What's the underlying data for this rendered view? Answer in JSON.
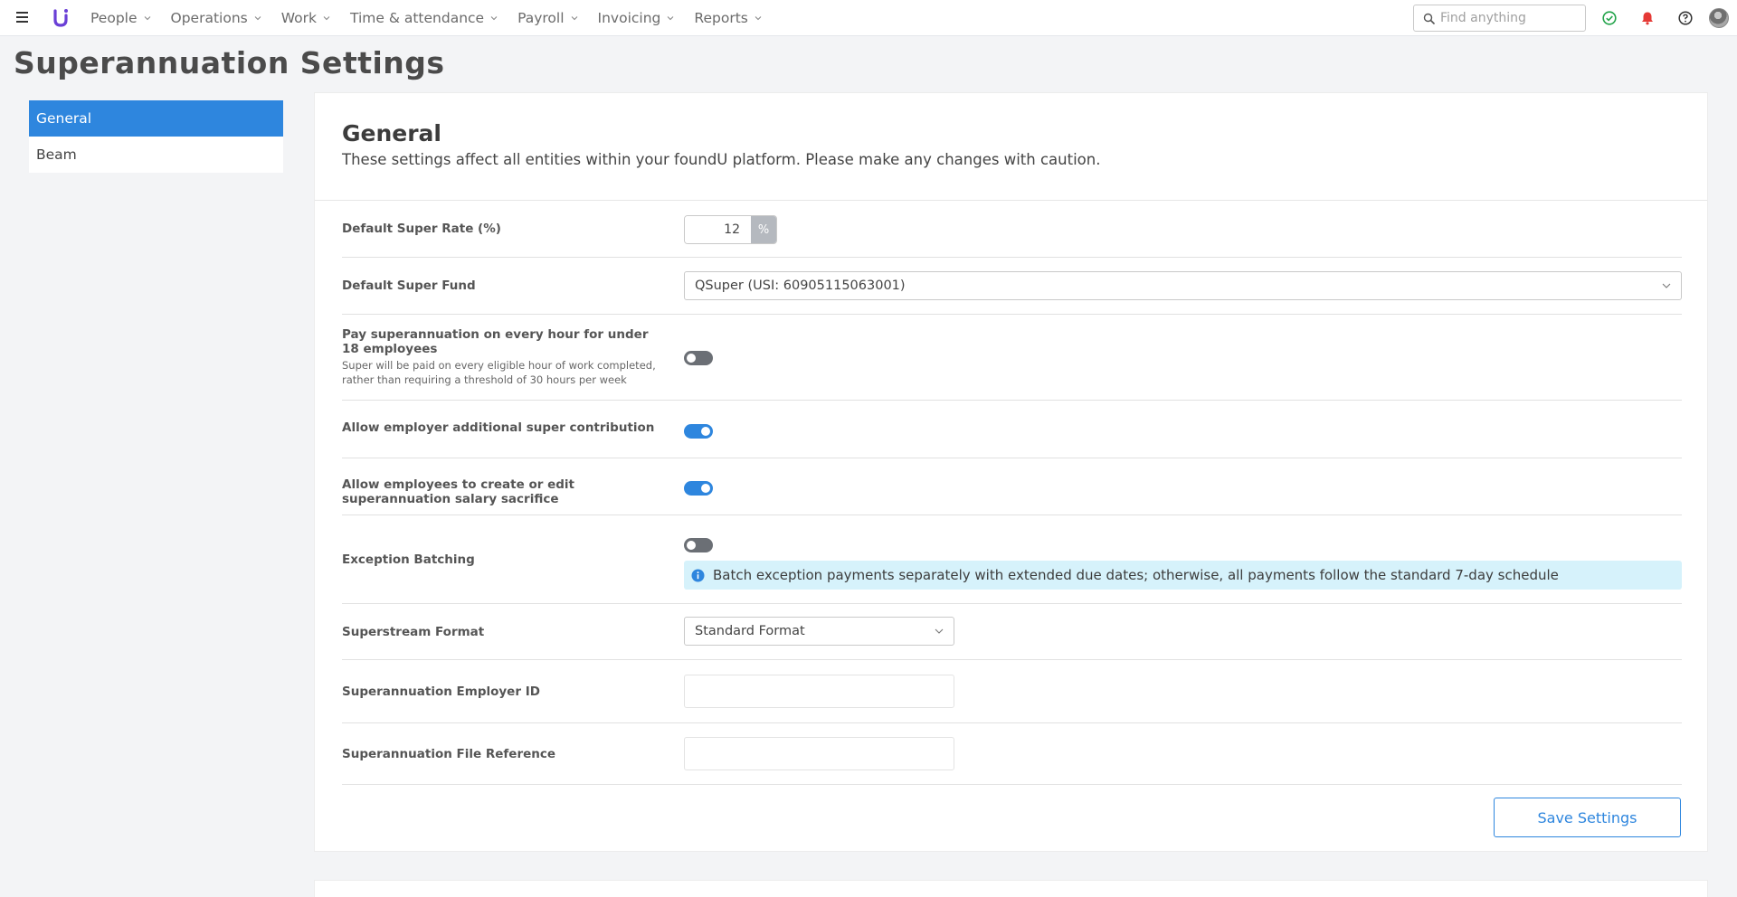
{
  "nav": {
    "items": [
      {
        "label": "People"
      },
      {
        "label": "Operations"
      },
      {
        "label": "Work"
      },
      {
        "label": "Time & attendance"
      },
      {
        "label": "Payroll"
      },
      {
        "label": "Invoicing"
      },
      {
        "label": "Reports"
      }
    ],
    "search_placeholder": "Find anything",
    "icons": [
      "menu-icon",
      "logo-icon",
      "search-icon",
      "status-check-icon",
      "notification-bell-icon",
      "help-icon",
      "avatar"
    ],
    "colors": {
      "accent": "#2e86de",
      "check": "#22a34a",
      "bell": "#e53935",
      "logo": "#6a3fd6"
    }
  },
  "page": {
    "title": "Superannuation Settings"
  },
  "side_menu": {
    "items": [
      {
        "label": "General",
        "active": true
      },
      {
        "label": "Beam",
        "active": false
      }
    ]
  },
  "general": {
    "title": "General",
    "description": "These settings affect all entities within your foundU platform. Please make any changes with caution.",
    "default_rate": {
      "label": "Default Super Rate (%)",
      "value": "12",
      "addon": "%"
    },
    "default_fund": {
      "label": "Default Super Fund",
      "value": "QSuper (USI: 60905115063001)"
    },
    "under18": {
      "label": "Pay superannuation on every hour for under 18 employees",
      "sublabel": "Super will be paid on every eligible hour of work completed, rather than requiring a threshold of 30 hours per week",
      "enabled": false
    },
    "employer_additional": {
      "label": "Allow employer additional super contribution",
      "enabled": true
    },
    "salary_sacrifice": {
      "label": "Allow employees to create or edit superannuation salary sacrifice",
      "enabled": true
    },
    "exception_batching": {
      "label": "Exception Batching",
      "enabled": false,
      "info": "Batch exception payments separately with extended due dates; otherwise, all payments follow the standard 7-day schedule"
    },
    "superstream_format": {
      "label": "Superstream Format",
      "value": "Standard Format"
    },
    "employer_id": {
      "label": "Superannuation Employer ID",
      "value": ""
    },
    "file_reference": {
      "label": "Superannuation File Reference",
      "value": ""
    },
    "save_label": "Save Settings"
  }
}
